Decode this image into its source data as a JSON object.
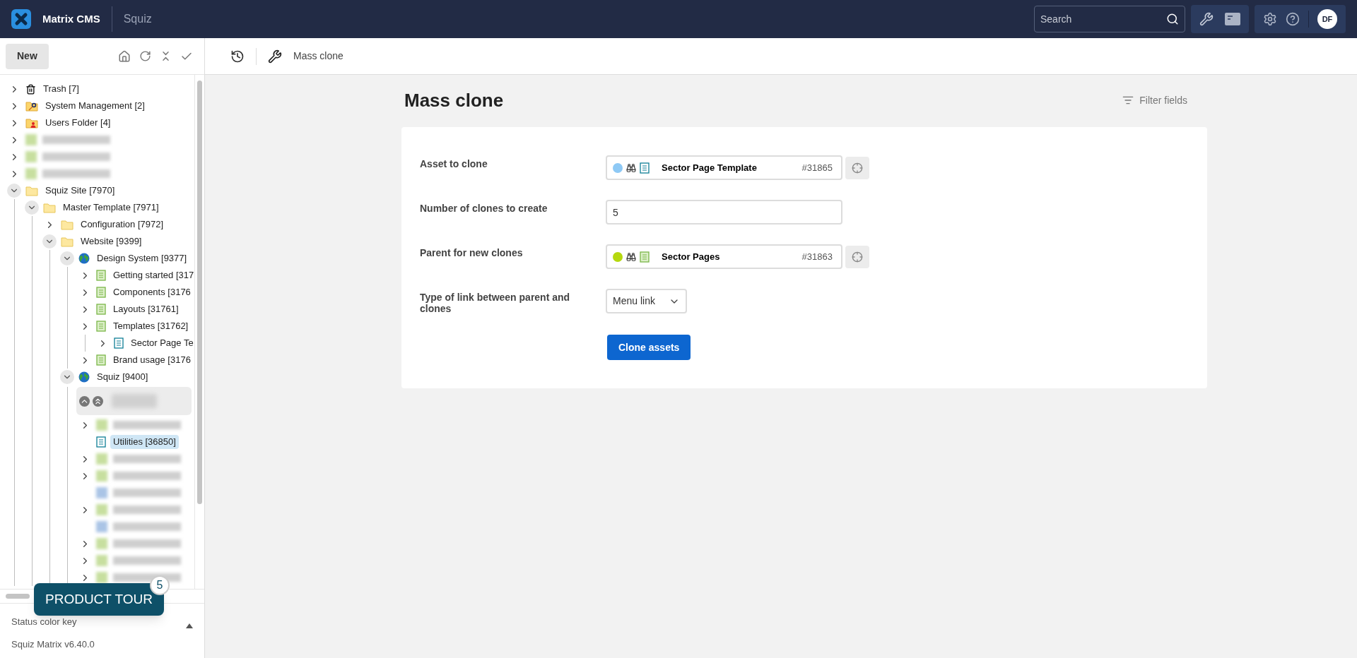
{
  "header": {
    "app_name": "Matrix CMS",
    "site": "Squiz",
    "search": {
      "placeholder": "Search"
    },
    "avatar": "DF"
  },
  "sidebar": {
    "new_button": "New",
    "tree": [
      {
        "label": "Trash [7]",
        "kind": "trash",
        "expanded": false,
        "selected": false
      },
      {
        "label": "System Management [2]",
        "kind": "folder-key",
        "expanded": false,
        "selected": false
      },
      {
        "label": "Users Folder [4]",
        "kind": "folder-user",
        "expanded": false,
        "selected": false
      },
      {
        "kind": "blurred",
        "expanded": false,
        "selected": false
      },
      {
        "kind": "blurred",
        "expanded": false,
        "selected": false
      },
      {
        "kind": "blurred",
        "expanded": false,
        "selected": false
      },
      {
        "label": "Squiz Site [7970]",
        "kind": "folder",
        "expanded": true,
        "selected": false,
        "children": [
          {
            "label": "Master Template [7971]",
            "kind": "folder",
            "expanded": true,
            "selected": false,
            "children": [
              {
                "label": "Configuration [7972]",
                "kind": "folder",
                "expanded": false,
                "selected": false
              },
              {
                "label": "Website [9399]",
                "kind": "folder",
                "expanded": true,
                "selected": false,
                "children": [
                  {
                    "label": "Design System [9377]",
                    "kind": "site",
                    "expanded": true,
                    "selected": false,
                    "children": [
                      {
                        "label": "Getting started [317",
                        "kind": "page",
                        "expanded": false,
                        "selected": false
                      },
                      {
                        "label": "Components [3176",
                        "kind": "page",
                        "expanded": false,
                        "selected": false
                      },
                      {
                        "label": "Layouts [31761]",
                        "kind": "page",
                        "expanded": false,
                        "selected": false
                      },
                      {
                        "label": "Templates [31762]",
                        "kind": "page",
                        "expanded": false,
                        "selected": false,
                        "children": [
                          {
                            "label": "Sector Page Te",
                            "kind": "template",
                            "expanded": false,
                            "selected": false
                          }
                        ]
                      },
                      {
                        "label": "Brand usage [3176",
                        "kind": "page",
                        "expanded": false,
                        "selected": false
                      }
                    ]
                  },
                  {
                    "label": "Squiz [9400]",
                    "kind": "site",
                    "expanded": true,
                    "selected": false,
                    "children": [
                      {
                        "kind": "pager",
                        "selected": false
                      },
                      {
                        "kind": "blurred",
                        "expanded": false,
                        "selected": false
                      },
                      {
                        "label": "Utilities [36850]",
                        "kind": "template",
                        "selected": true
                      },
                      {
                        "kind": "blurred",
                        "expanded": false,
                        "selected": false
                      },
                      {
                        "kind": "blurred",
                        "expanded": false,
                        "selected": false
                      },
                      {
                        "kind": "blurred-template",
                        "selected": false
                      },
                      {
                        "kind": "blurred",
                        "expanded": false,
                        "selected": false
                      },
                      {
                        "kind": "blurred-template",
                        "selected": false
                      },
                      {
                        "kind": "blurred",
                        "expanded": false,
                        "selected": false
                      },
                      {
                        "kind": "blurred",
                        "expanded": false,
                        "selected": false
                      },
                      {
                        "kind": "blurred",
                        "expanded": false,
                        "selected": false
                      }
                    ]
                  }
                ]
              }
            ]
          }
        ]
      }
    ],
    "status_key": "Status color key",
    "version": "Squiz Matrix v6.40.0"
  },
  "product_tour": {
    "label": "PRODUCT TOUR",
    "count": "5"
  },
  "toolbar": {
    "title": "Mass clone"
  },
  "page": {
    "title": "Mass clone",
    "filter": "Filter fields",
    "fields": [
      {
        "kind": "asset",
        "label": "Asset to clone",
        "color": "#8ec9f5",
        "name": "Sector Page Template",
        "id": "#31865"
      },
      {
        "kind": "text",
        "label": "Number of clones to create",
        "value": "5"
      },
      {
        "kind": "asset",
        "label": "Parent for new clones",
        "color": "#b5d80f",
        "name": "Sector Pages",
        "id": "#31863"
      },
      {
        "kind": "select",
        "label": "Type of link between parent and clones",
        "value": "Menu link"
      }
    ],
    "submit": "Clone assets"
  }
}
